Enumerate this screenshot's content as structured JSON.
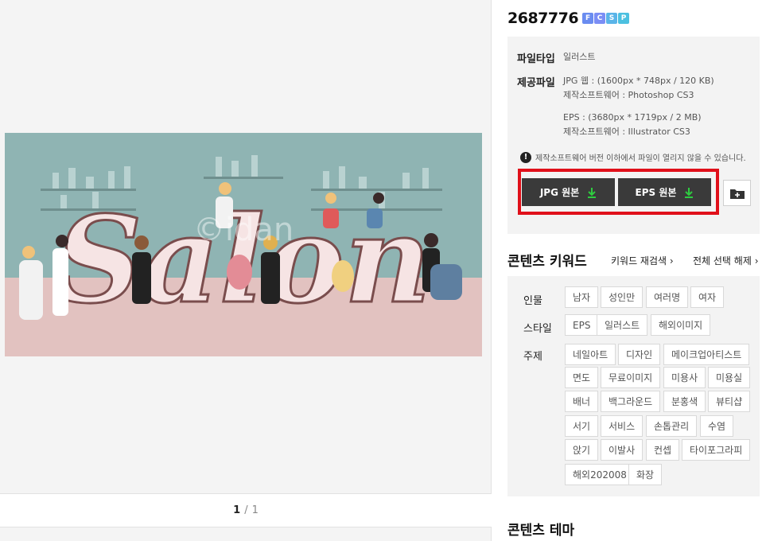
{
  "content_id": "2687776",
  "license_badges": [
    {
      "letter": "F",
      "color": "#6a8cf0"
    },
    {
      "letter": "C",
      "color": "#7b8ef5"
    },
    {
      "letter": "S",
      "color": "#5ab4e8"
    },
    {
      "letter": "P",
      "color": "#4cc0e0"
    }
  ],
  "preview": {
    "watermark": "©idan",
    "artwork_word": "Salon"
  },
  "pager": {
    "current": "1",
    "separator": "/",
    "total": "1"
  },
  "info": {
    "file_type_label": "파일타입",
    "file_type_value": "일러스트",
    "files_label": "제공파일",
    "jpg_line1": "JPG 웹 : (1600px * 748px / 120 KB)",
    "jpg_line2": "제작소프트웨어 : Photoshop CS3",
    "eps_line1": "EPS : (3680px * 1719px / 2 MB)",
    "eps_line2": "제작소프트웨어 : Illustrator CS3",
    "warning": "제작소프트웨어 버전 이하에서 파일이 열리지 않을 수 있습니다."
  },
  "buttons": {
    "jpg": "JPG 원본",
    "eps": "EPS 원본"
  },
  "keywords": {
    "title": "콘텐츠 키워드",
    "research": "키워드 재검색",
    "select_all": "전체 선택 해제",
    "categories": [
      {
        "label": "인물",
        "tags": [
          "남자",
          "성인만",
          "여러명",
          "여자"
        ]
      },
      {
        "label": "스타일",
        "tags": [
          "EPS",
          "일러스트",
          "해외이미지"
        ]
      },
      {
        "label": "주제",
        "tags": [
          "네일아트",
          "디자인",
          "메이크업아티스트",
          "면도",
          "무료이미지",
          "미용사",
          "미용실",
          "배너",
          "백그라운드",
          "분홍색",
          "뷰티샵",
          "서기",
          "서비스",
          "손톱관리",
          "수염",
          "앉기",
          "이발사",
          "컨셉",
          "타이포그라피",
          "해외202008",
          "화장"
        ]
      }
    ]
  },
  "theme": {
    "title": "콘텐츠 테마"
  },
  "colors": {
    "highlight_border": "#e0101a",
    "button_bg": "#3a3a3a",
    "download_arrow": "#2ecc40",
    "panel_bg": "#f3f3f3"
  }
}
